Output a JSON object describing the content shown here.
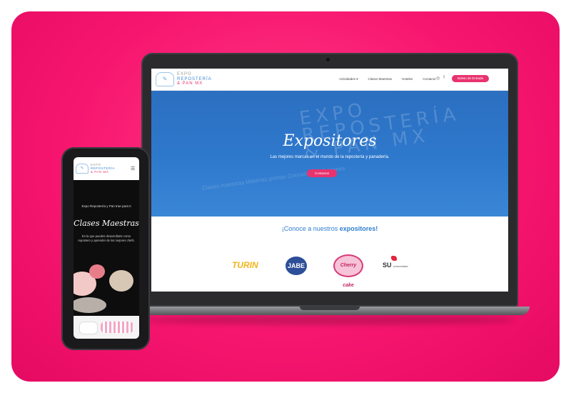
{
  "site": {
    "logo_mark": "EXPO",
    "logo_line1": "EXPO",
    "logo_line2": "REPOSTERÍA",
    "logo_line3": "& PAN MX"
  },
  "nav": {
    "items": [
      "Actividades ▾",
      "Clases Maestras",
      "Hoteles",
      "Contacto"
    ],
    "social": [
      "instagram-icon",
      "facebook-icon"
    ],
    "cta_label": "Boleto de Entrada"
  },
  "hero": {
    "bg_text_line1": "EXPO",
    "bg_text_line2": "REPOSTERÍA",
    "bg_text_line3": "& PAN MX",
    "bg_tags": "Clases maestras  Materias primas  Concurso  Exhibiciones",
    "title": "Expositores",
    "subtitle": "Las mejores marcas en el mundo de la repostería y panadería.",
    "button_label": "Contactos"
  },
  "section": {
    "heading_prefix": "¡Conoce a nuestros ",
    "heading_bold": "expositores!"
  },
  "brands": [
    {
      "name": "TURIN"
    },
    {
      "name": "JABE"
    },
    {
      "name": "Cherry cake"
    },
    {
      "name": "SU",
      "sub": "universidad"
    }
  ],
  "mobile": {
    "intro": "Expo Repostería y Pan trae para ti",
    "title": "Clases Maestras",
    "text": "En la que puedes desarrollarte como repostero y aprender de los mejores chefs.",
    "menu_icon": "hamburger-icon"
  },
  "colors": {
    "background": "#f7166f",
    "accent": "#e8336f",
    "hero_blue": "#2e78cc",
    "brand_blue": "#2f7fd0"
  }
}
